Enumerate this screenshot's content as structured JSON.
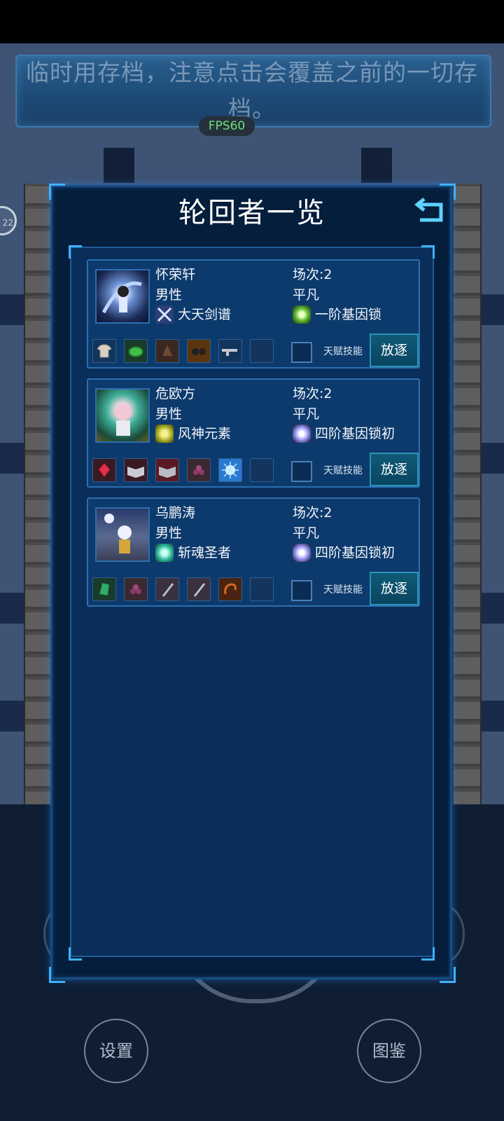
{
  "hint": {
    "text": "临时用存档，注意点击会覆盖之前的一切存档。"
  },
  "fps": {
    "label": "FPS60"
  },
  "badge": {
    "text": "22"
  },
  "panel": {
    "title": "轮回者一览"
  },
  "characters": [
    {
      "name": "怀荣轩",
      "gender": "男性",
      "rounds": "场次:2",
      "rank": "平凡",
      "talent": "大天剑谱",
      "gene": "一阶基因锁",
      "talent_skill_label": "天赋技能",
      "exile_label": "放逐",
      "avatar_color": "#7aa2d8",
      "items": [
        "shirt-item",
        "green-ore-item",
        "brown-seed-item",
        "goggles-item",
        "gun-item",
        "empty-slot"
      ]
    },
    {
      "name": "危欧方",
      "gender": "男性",
      "rounds": "场次:2",
      "rank": "平凡",
      "talent": "风神元素",
      "gene": "四阶基因锁初",
      "talent_skill_label": "天赋技能",
      "exile_label": "放逐",
      "avatar_color": "#e8b8c8",
      "items": [
        "red-gem-item",
        "book-item",
        "book-red-item",
        "berry-item",
        "blue-orb-item",
        "empty-slot"
      ]
    },
    {
      "name": "乌鹏涛",
      "gender": "男性",
      "rounds": "场次:2",
      "rank": "平凡",
      "talent": "斩魂圣者",
      "gene": "四阶基因锁初",
      "talent_skill_label": "天赋技能",
      "exile_label": "放逐",
      "avatar_color": "#b8c8e8",
      "items": [
        "green-crystal-item",
        "berry-item",
        "blade-item",
        "blade-item",
        "horn-item",
        "empty-slot"
      ]
    }
  ],
  "bottom": {
    "settings_label": "设置",
    "codex_label": "图鉴"
  },
  "colors": {
    "accent": "#3fb2ff",
    "panel_bg": "#051e3c",
    "card_bg": "#0d3a6c",
    "fps_green": "#6be07a"
  }
}
